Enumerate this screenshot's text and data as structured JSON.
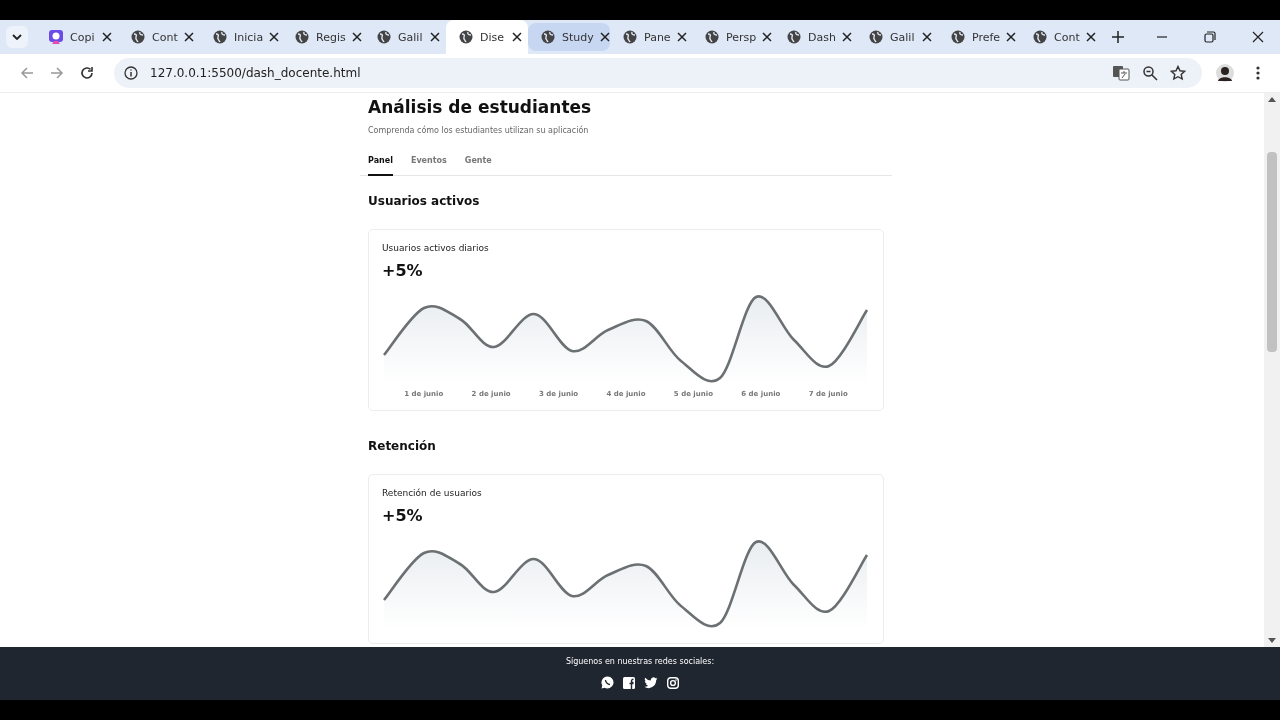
{
  "browser": {
    "tabs": [
      {
        "title": "Copi",
        "selected": false,
        "hovered": false,
        "kind": "app"
      },
      {
        "title": "Cont",
        "selected": false,
        "hovered": false,
        "kind": "globe"
      },
      {
        "title": "Inicia",
        "selected": false,
        "hovered": false,
        "kind": "globe"
      },
      {
        "title": "Regis",
        "selected": false,
        "hovered": false,
        "kind": "globe"
      },
      {
        "title": "Galil",
        "selected": false,
        "hovered": false,
        "kind": "globe"
      },
      {
        "title": "Dise",
        "selected": true,
        "hovered": false,
        "kind": "globe"
      },
      {
        "title": "Study",
        "selected": false,
        "hovered": true,
        "kind": "globe"
      },
      {
        "title": "Pane",
        "selected": false,
        "hovered": false,
        "kind": "globe"
      },
      {
        "title": "Persp",
        "selected": false,
        "hovered": false,
        "kind": "globe"
      },
      {
        "title": "Dash",
        "selected": false,
        "hovered": false,
        "kind": "globe"
      },
      {
        "title": "Galil",
        "selected": false,
        "hovered": false,
        "kind": "globe"
      },
      {
        "title": "Prefe",
        "selected": false,
        "hovered": false,
        "kind": "globe"
      },
      {
        "title": "Cont",
        "selected": false,
        "hovered": false,
        "kind": "globe"
      }
    ],
    "address": "127.0.0.1:5500/dash_docente.html"
  },
  "page": {
    "title": "Análisis de estudiantes",
    "subtitle": "Comprenda cómo los estudiantes utilizan su aplicación",
    "tabs": [
      {
        "label": "Panel",
        "selected": true
      },
      {
        "label": "Eventos",
        "selected": false
      },
      {
        "label": "Gente",
        "selected": false
      }
    ],
    "sections": [
      {
        "heading": "Usuarios activos",
        "card": {
          "title": "Usuarios activos diarios",
          "value": "+5%",
          "x_labels": [
            "1 de junio",
            "2 de junio",
            "3 de junio",
            "4 de junio",
            "5 de junio",
            "6 de junio",
            "7 de junio"
          ]
        }
      },
      {
        "heading": "Retención",
        "card": {
          "title": "Retención de usuarios",
          "value": "+5%"
        }
      }
    ]
  },
  "footer": {
    "text": "Síguenos en nuestras redes sociales:"
  }
}
